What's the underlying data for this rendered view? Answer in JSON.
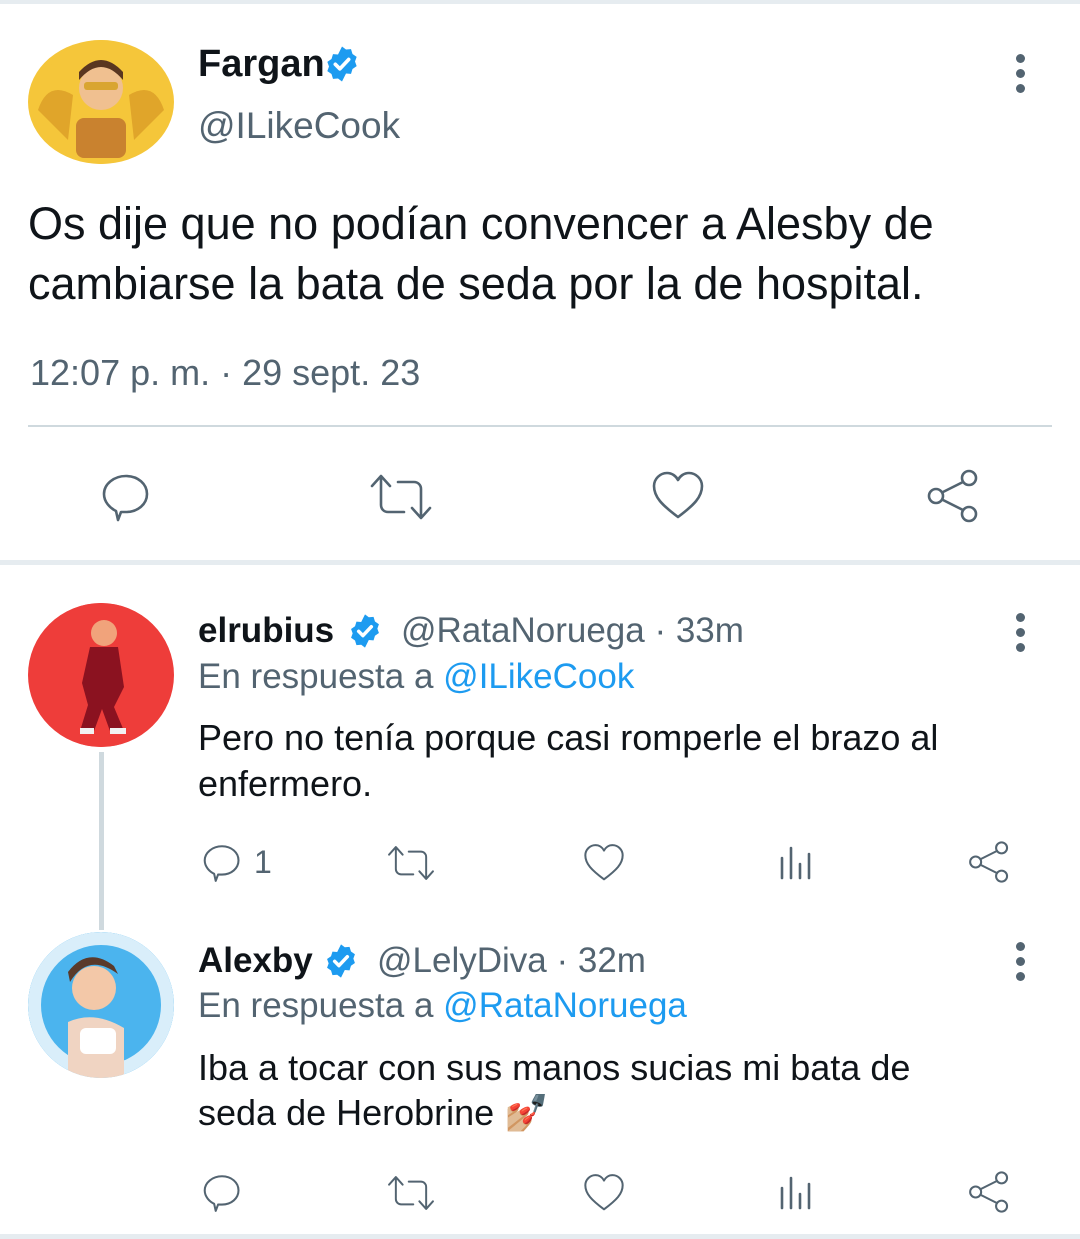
{
  "main_tweet": {
    "author": "Fargan",
    "handle": "@ILikeCook",
    "text_line1": "Os dije que no podían convencer a Alesby de",
    "text_line2": "cambiarse la bata de seda por la de hospital.",
    "timestamp": "12:07 p. m. · 29 sept. 23"
  },
  "reply1": {
    "author": "elrubius",
    "handle_time": "@RataNoruega · 33m",
    "reply_prefix": "En respuesta a",
    "reply_to": "@ILikeCook",
    "text_line1": "Pero no tenía porque casi romperle el brazo al",
    "text_line2": "enfermero.",
    "reply_count": "1"
  },
  "reply2": {
    "author": "Alexby",
    "handle_time": "@LelyDiva · 32m",
    "reply_prefix": "En respuesta a",
    "reply_to": "@RataNoruega",
    "text_line1": "Iba a tocar con sus manos sucias mi bata de",
    "text_line2": "seda de Herobrine",
    "emoji": "💅🏼"
  },
  "colors": {
    "accent": "#1d9bf0",
    "text_primary": "#0f1419",
    "text_secondary": "#536471",
    "fargan_avatar_bg": "#f5c63a",
    "rubius_avatar_bg": "#ee3d3a",
    "alexby_avatar_bg": "#4bb4ee"
  }
}
